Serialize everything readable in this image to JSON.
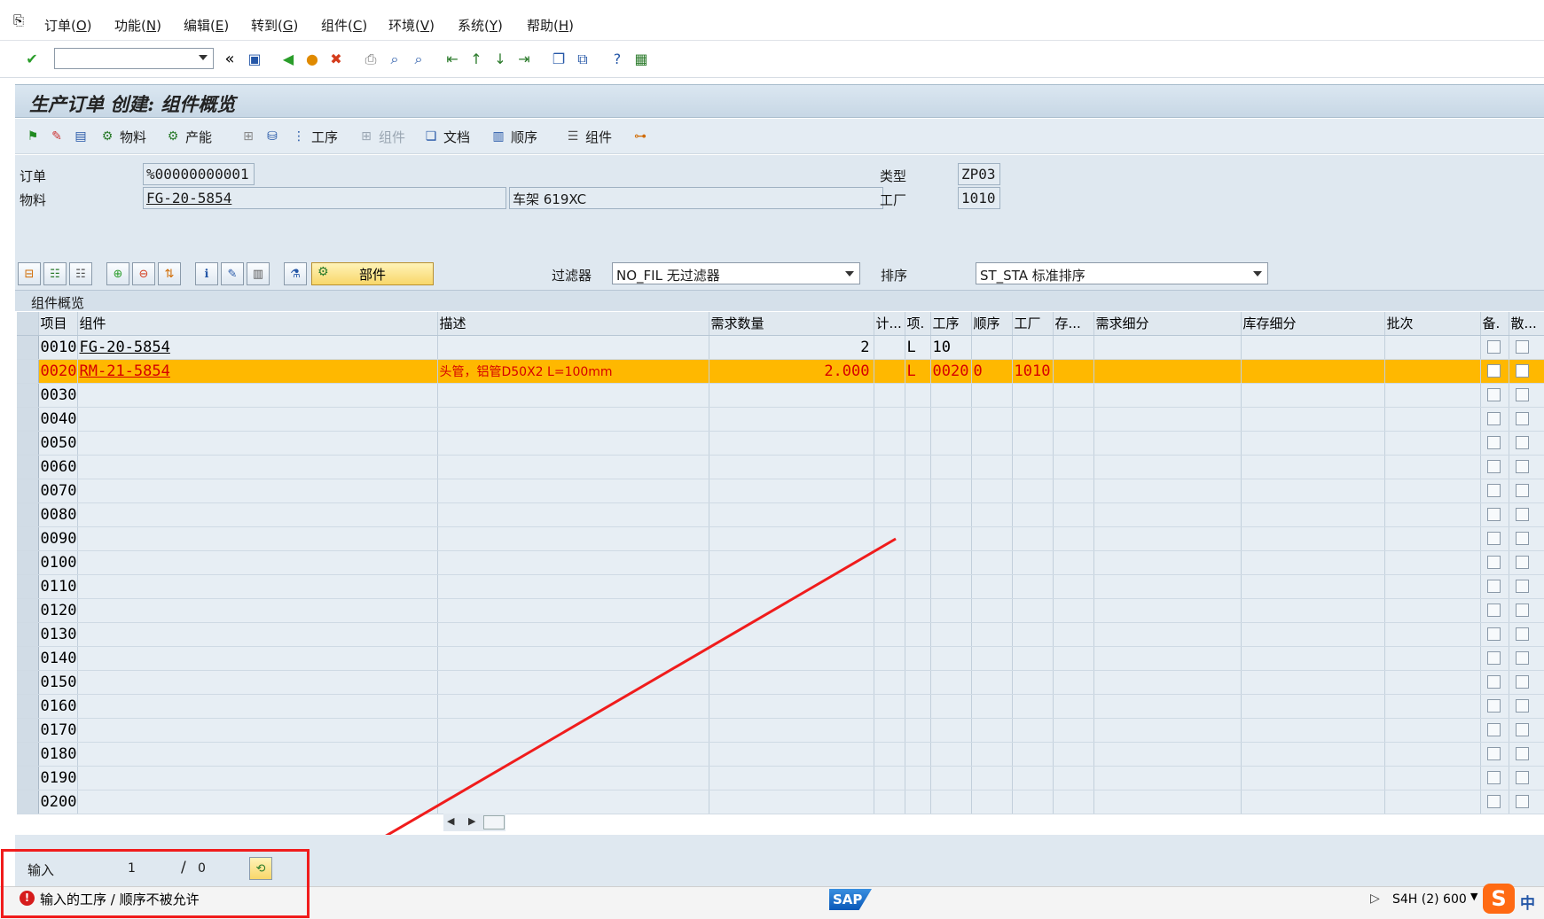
{
  "menu": {
    "items": [
      {
        "label": "订单(",
        "key": "O",
        "suffix": ")"
      },
      {
        "label": "功能(",
        "key": "N",
        "suffix": ")"
      },
      {
        "label": "编辑(",
        "key": "E",
        "suffix": ")"
      },
      {
        "label": "转到(",
        "key": "G",
        "suffix": ")"
      },
      {
        "label": "组件(",
        "key": "C",
        "suffix": ")"
      },
      {
        "label": "环境(",
        "key": "V",
        "suffix": ")"
      },
      {
        "label": "系统(",
        "key": "Y",
        "suffix": ")"
      },
      {
        "label": "帮助(",
        "key": "H",
        "suffix": ")"
      }
    ]
  },
  "toolbar": {
    "command_value": "",
    "collapse_glyph": "«"
  },
  "title": "生产订单 创建: 组件概览",
  "app_toolbar": {
    "material": "物料",
    "capacity": "产能",
    "operation": "工序",
    "component_dim": "组件",
    "document": "文档",
    "sequence": "顺序",
    "component": "组件"
  },
  "header": {
    "order_label": "订单",
    "order_value": "%00000000001",
    "material_label": "物料",
    "material_value": "FG-20-5854",
    "material_desc": "车架 619XC",
    "type_label": "类型",
    "type_value": "ZP03",
    "plant_label": "工厂",
    "plant_value": "1010"
  },
  "table_controls": {
    "part_button": "部件",
    "filter_label": "过滤器",
    "filter_value": "NO_FIL 无过滤器",
    "sort_label": "排序",
    "sort_value": "ST_STA 标准排序"
  },
  "grid": {
    "title": "组件概览",
    "columns": [
      "项目",
      "组件",
      "描述",
      "需求数量",
      "计...",
      "项.",
      "工序",
      "顺序",
      "工厂",
      "存...",
      "需求细分",
      "库存细分",
      "批次",
      "备.",
      "散..."
    ],
    "rows": [
      {
        "item": "0010",
        "component": "FG-20-5854",
        "desc": "",
        "qty": "2",
        "unit": "",
        "cat": "L",
        "op": "10",
        "seq": "",
        "plant": "",
        "sloc": ""
      },
      {
        "item": "0020",
        "component": "RM-21-5854",
        "desc": "头管，铝管D50X2 L=100mm",
        "qty": "2.000",
        "unit": "",
        "cat": "L",
        "op": "0020",
        "seq": "0",
        "plant": "1010",
        "sloc": ""
      },
      {
        "item": "0030"
      },
      {
        "item": "0040"
      },
      {
        "item": "0050"
      },
      {
        "item": "0060"
      },
      {
        "item": "0070"
      },
      {
        "item": "0080"
      },
      {
        "item": "0090"
      },
      {
        "item": "0100"
      },
      {
        "item": "0110"
      },
      {
        "item": "0120"
      },
      {
        "item": "0130"
      },
      {
        "item": "0140"
      },
      {
        "item": "0150"
      },
      {
        "item": "0160"
      },
      {
        "item": "0170"
      },
      {
        "item": "0180"
      },
      {
        "item": "0190"
      },
      {
        "item": "0200"
      }
    ],
    "highlight_row": 1
  },
  "entry": {
    "label": "输入",
    "current": "1",
    "separator": "/",
    "total": "0"
  },
  "status": {
    "message": "输入的工序 / 顺序不被允许",
    "system": "S4H (2) 600",
    "ime": "中"
  },
  "colors": {
    "highlight": "#ffb800",
    "error_text": "#d60000",
    "annotation": "#f01c1c"
  }
}
